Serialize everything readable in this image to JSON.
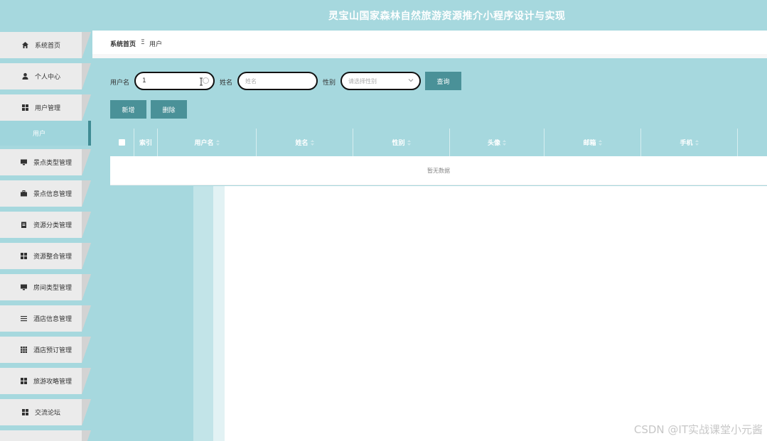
{
  "app": {
    "title": "灵宝山国家森林自然旅游资源推介小程序设计与实现"
  },
  "sidebar": {
    "items": [
      {
        "label": "系统首页",
        "icon": "home-icon"
      },
      {
        "label": "个人中心",
        "icon": "user-icon"
      },
      {
        "label": "用户管理",
        "icon": "grid-icon"
      },
      {
        "label": "景点类型管理",
        "icon": "monitor-icon"
      },
      {
        "label": "景点信息管理",
        "icon": "briefcase-icon"
      },
      {
        "label": "资源分类管理",
        "icon": "clipboard-icon"
      },
      {
        "label": "资源整合管理",
        "icon": "grid-icon"
      },
      {
        "label": "房间类型管理",
        "icon": "monitor-icon"
      },
      {
        "label": "酒店信息管理",
        "icon": "list-icon"
      },
      {
        "label": "酒店预订管理",
        "icon": "grid9-icon"
      },
      {
        "label": "旅游攻略管理",
        "icon": "grid-icon"
      },
      {
        "label": "交流论坛",
        "icon": "grid-icon"
      }
    ],
    "submenu": {
      "label": "用户"
    }
  },
  "breadcrumb": {
    "home": "系统首页",
    "separator": "Ξ",
    "current": "用户"
  },
  "search": {
    "username_label": "用户名",
    "username_value": "1",
    "name_label": "姓名",
    "name_placeholder": "姓名",
    "gender_label": "性别",
    "gender_placeholder": "请选择性别",
    "query_button": "查询"
  },
  "actions": {
    "add_button": "新增",
    "delete_button": "删除"
  },
  "table": {
    "columns": [
      "索引",
      "用户名",
      "姓名",
      "性别",
      "头像",
      "邮箱",
      "手机"
    ],
    "empty_text": "暂无数据"
  },
  "watermark": "CSDN @IT实战课堂小元酱",
  "colors": {
    "primary": "#a6d8de",
    "button": "#4a9198",
    "active_border": "#3f8b93"
  }
}
